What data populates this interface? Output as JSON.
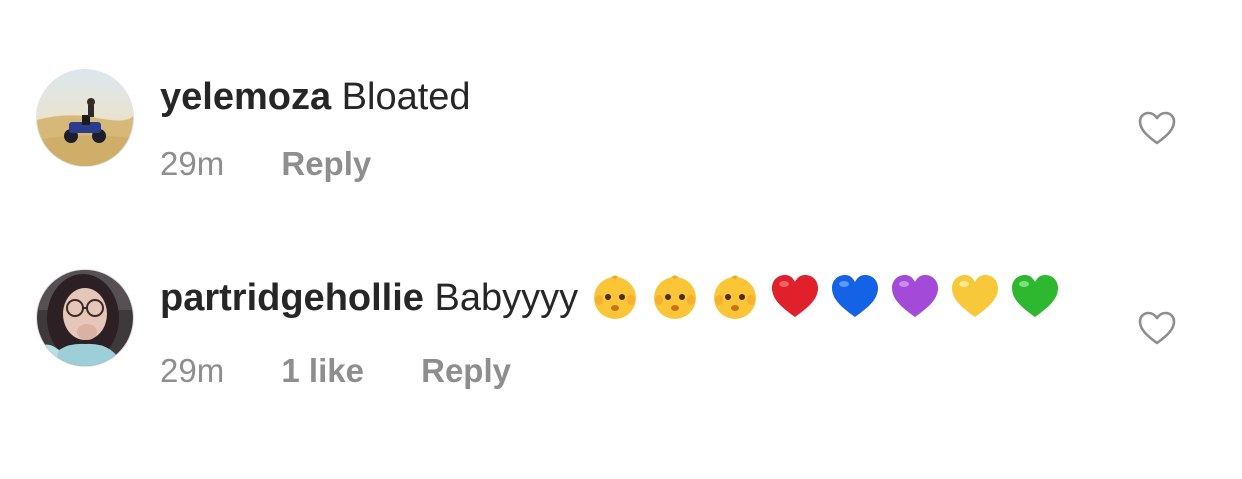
{
  "comments": [
    {
      "username": "yelemoza",
      "text": "Bloated",
      "emojis": [],
      "time": "29m",
      "likes": "",
      "reply_label": "Reply"
    },
    {
      "username": "partridgehollie",
      "text": "Babyyyy",
      "emojis": [
        "baby-emoji",
        "baby-emoji",
        "baby-emoji",
        "red-heart-emoji",
        "blue-heart-emoji",
        "purple-heart-emoji",
        "yellow-heart-emoji",
        "green-heart-emoji"
      ],
      "time": "29m",
      "likes": "1 like",
      "reply_label": "Reply"
    }
  ],
  "colors": {
    "text": "#262626",
    "secondary": "#8e8e8e",
    "red_heart": "#e0202b",
    "blue_heart": "#1463e6",
    "purple_heart": "#a34ad8",
    "yellow_heart": "#f7c93a",
    "green_heart": "#2db82f"
  }
}
